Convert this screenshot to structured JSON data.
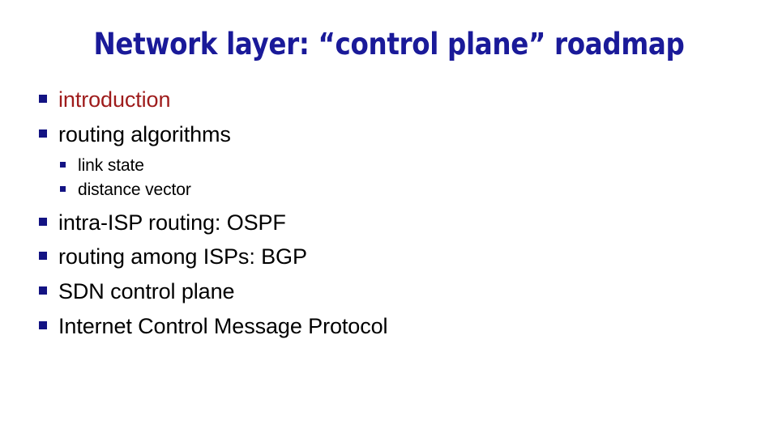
{
  "slide": {
    "title": "Network layer: “control plane” roadmap",
    "title_color": "#1a1a99",
    "background_color": "#ffffff",
    "bullet_marker_color": "#131383",
    "accent_text_color": "#9e1b1b",
    "default_text_color": "#000000",
    "bullets": [
      {
        "label": "introduction",
        "level": 1,
        "color": "#9e1b1b"
      },
      {
        "label": "routing algorithms",
        "level": 1,
        "color": "#000000"
      },
      {
        "label": "link state",
        "level": 2,
        "color": "#000000"
      },
      {
        "label": "distance vector",
        "level": 2,
        "color": "#000000"
      },
      {
        "label": "intra-ISP routing: OSPF",
        "level": 1,
        "color": "#000000"
      },
      {
        "label": "routing among ISPs: BGP",
        "level": 1,
        "color": "#000000"
      },
      {
        "label": "SDN control plane",
        "level": 1,
        "color": "#000000"
      },
      {
        "label": "Internet Control Message Protocol",
        "level": 1,
        "color": "#000000"
      }
    ]
  }
}
